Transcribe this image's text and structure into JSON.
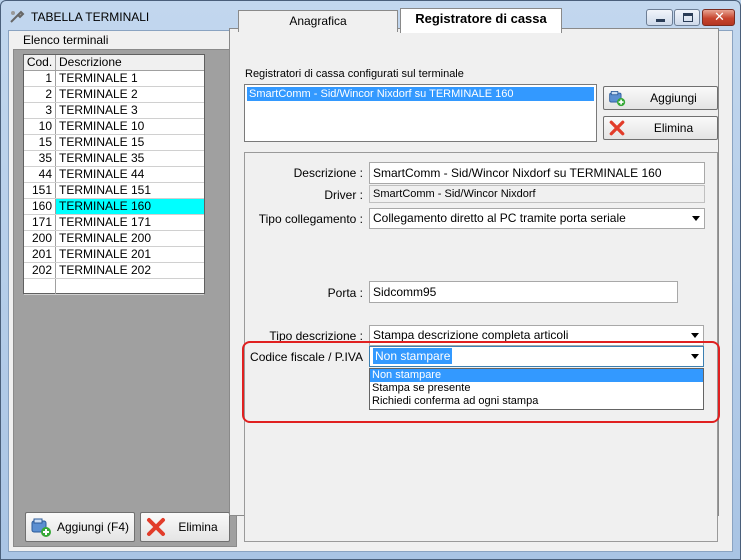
{
  "window": {
    "title": "TABELLA TERMINALI"
  },
  "left": {
    "label": "Elenco terminali",
    "columns": {
      "cod": "Cod.",
      "desc": "Descrizione"
    },
    "rows": [
      {
        "cod": "1",
        "desc": "TERMINALE 1"
      },
      {
        "cod": "2",
        "desc": "TERMINALE 2"
      },
      {
        "cod": "3",
        "desc": "TERMINALE 3"
      },
      {
        "cod": "10",
        "desc": "TERMINALE 10"
      },
      {
        "cod": "15",
        "desc": "TERMINALE 15"
      },
      {
        "cod": "35",
        "desc": "TERMINALE 35"
      },
      {
        "cod": "44",
        "desc": "TERMINALE 44"
      },
      {
        "cod": "151",
        "desc": "TERMINALE 151"
      },
      {
        "cod": "160",
        "desc": "TERMINALE 160"
      },
      {
        "cod": "171",
        "desc": "TERMINALE 171"
      },
      {
        "cod": "200",
        "desc": "TERMINALE 200"
      },
      {
        "cod": "201",
        "desc": "TERMINALE 201"
      },
      {
        "cod": "202",
        "desc": "TERMINALE 202"
      }
    ],
    "selected_cod": "160",
    "add_label": "Aggiungi (F4)",
    "delete_label": "Elimina"
  },
  "tabs": {
    "anagrafica": "Anagrafica",
    "registratore": "Registratore di cassa"
  },
  "registratori": {
    "label": "Registratori di cassa configurati sul terminale",
    "items": [
      "SmartComm - Sid/Wincor Nixdorf su TERMINALE 160"
    ],
    "add_label": "Aggiungi",
    "delete_label": "Elimina"
  },
  "form": {
    "descrizione_label": "Descrizione :",
    "descrizione_value": "SmartComm - Sid/Wincor Nixdorf su TERMINALE 160",
    "driver_label": "Driver :",
    "driver_value": "SmartComm - Sid/Wincor Nixdorf",
    "tipo_collegamento_label": "Tipo collegamento :",
    "tipo_collegamento_value": "Collegamento diretto al PC tramite porta seriale",
    "porta_label": "Porta :",
    "porta_value": "Sidcomm95",
    "tipo_descrizione_label": "Tipo descrizione :",
    "tipo_descrizione_value": "Stampa descrizione completa articoli",
    "codice_fiscale_label": "Codice fiscale / P.IVA",
    "codice_fiscale_value": "Non stampare",
    "codice_fiscale_options": [
      "Non stampare",
      "Stampa se presente",
      "Richiedi conferma ad ogni stampa"
    ]
  },
  "colors": {
    "selection": "#3399ff",
    "grid_selection": "#00ffff",
    "highlight": "#e02020"
  }
}
